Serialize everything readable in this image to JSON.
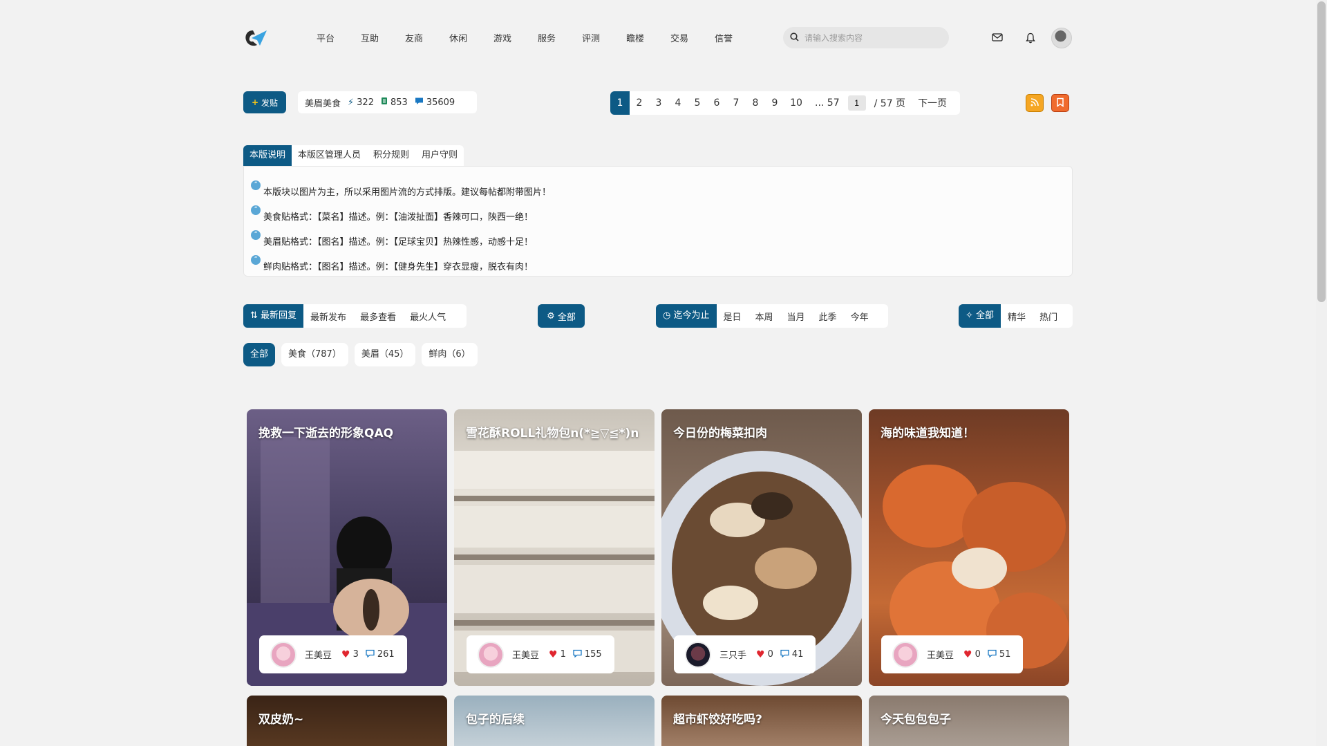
{
  "header": {
    "logo_name": "site-logo",
    "nav": [
      "平台",
      "互助",
      "友商",
      "休闲",
      "游戏",
      "服务",
      "评测",
      "瞻楼",
      "交易",
      "信誉"
    ],
    "search_placeholder": "请输入搜索内容"
  },
  "toolbar": {
    "post_label": "发贴",
    "board_name": "美眉美食",
    "threads": "322",
    "posts": "853",
    "replies": "35609"
  },
  "pager": {
    "pages": [
      "1",
      "2",
      "3",
      "4",
      "5",
      "6",
      "7",
      "8",
      "9",
      "10"
    ],
    "last": "... 57",
    "input_value": "1",
    "total": "/ 57 页",
    "next": "下一页"
  },
  "rules_tabs": [
    "本版说明",
    "本版区管理人员",
    "积分规则",
    "用户守则"
  ],
  "rules": [
    "本版块以图片为主，所以采用图片流的方式排版。建议每帖都附带图片！",
    "美食贴格式：【菜名】描述。例：【油泼扯面】香辣可口，陕西一绝！",
    "美眉贴格式：【图名】描述。例：【足球宝贝】热辣性感，动感十足！",
    "鲜肉贴格式：【图名】描述。例：【健身先生】穿衣显瘦，脱衣有肉！"
  ],
  "sort": {
    "items": [
      "最新回复",
      "最新发布",
      "最多查看",
      "最火人气"
    ],
    "all": "全部",
    "time": [
      "迄今为止",
      "是日",
      "本周",
      "当月",
      "此季",
      "今年"
    ],
    "kind": [
      "全部",
      "精华",
      "热门"
    ]
  },
  "categories": [
    "全部",
    "美食（787）",
    "美眉（45）",
    "鲜肉（6）"
  ],
  "posts": [
    {
      "title": "挽救一下逝去的形象QAQ",
      "author": "王美豆",
      "likes": "3",
      "comments": "261"
    },
    {
      "title": "雪花酥ROLL礼物包n(*≧▽≦*)n",
      "author": "王美豆",
      "likes": "1",
      "comments": "155"
    },
    {
      "title": "今日份的梅菜扣肉",
      "author": "三只手",
      "likes": "0",
      "comments": "41"
    },
    {
      "title": "海的味道我知道！",
      "author": "王美豆",
      "likes": "0",
      "comments": "51"
    }
  ],
  "posts_row2": [
    "双皮奶~",
    "包子的后续",
    "超市虾饺好吃吗?",
    "今天包包包子"
  ],
  "colors": {
    "accent": "#0d5a85",
    "rss": "#f5a623",
    "fav": "#f06b2d"
  }
}
